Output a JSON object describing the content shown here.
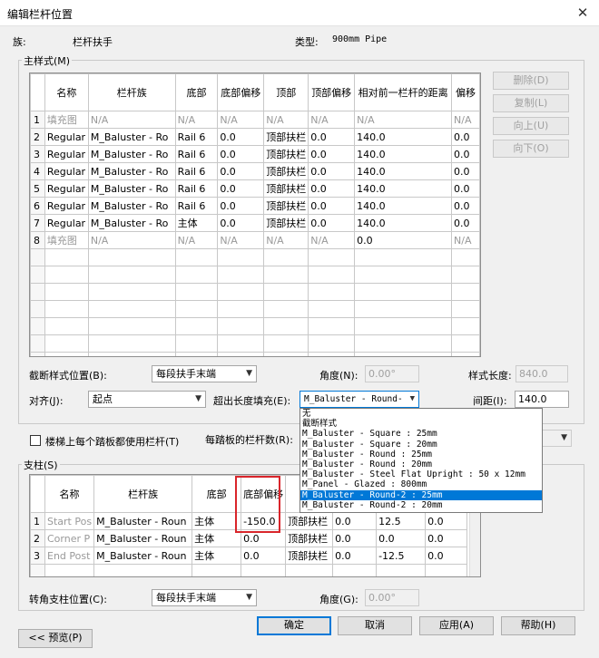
{
  "window": {
    "title": "编辑栏杆位置",
    "close_glyph": "✕"
  },
  "family": {
    "label": "族:",
    "value": "栏杆扶手",
    "type_label": "类型:",
    "type_value": "900mm Pipe"
  },
  "main_pattern": {
    "title": "主样式(M)",
    "columns": [
      "",
      "名称",
      "栏杆族",
      "底部",
      "底部偏移",
      "顶部",
      "顶部偏移",
      "相对前一栏杆的距离",
      "偏移"
    ],
    "rows": [
      [
        "1",
        "填充图",
        "N/A",
        "N/A",
        "N/A",
        "N/A",
        "N/A",
        "N/A",
        "N/A"
      ],
      [
        "2",
        "Regular",
        "M_Baluster - Ro",
        "Rail 6",
        "0.0",
        "顶部扶栏",
        "0.0",
        "140.0",
        "0.0"
      ],
      [
        "3",
        "Regular",
        "M_Baluster - Ro",
        "Rail 6",
        "0.0",
        "顶部扶栏",
        "0.0",
        "140.0",
        "0.0"
      ],
      [
        "4",
        "Regular",
        "M_Baluster - Ro",
        "Rail 6",
        "0.0",
        "顶部扶栏",
        "0.0",
        "140.0",
        "0.0"
      ],
      [
        "5",
        "Regular",
        "M_Baluster - Ro",
        "Rail 6",
        "0.0",
        "顶部扶栏",
        "0.0",
        "140.0",
        "0.0"
      ],
      [
        "6",
        "Regular",
        "M_Baluster - Ro",
        "Rail 6",
        "0.0",
        "顶部扶栏",
        "0.0",
        "140.0",
        "0.0"
      ],
      [
        "7",
        "Regular",
        "M_Baluster - Ro",
        "主体",
        "0.0",
        "顶部扶栏",
        "0.0",
        "140.0",
        "0.0"
      ],
      [
        "8",
        "填充图",
        "N/A",
        "N/A",
        "N/A",
        "N/A",
        "N/A",
        "0.0",
        "N/A"
      ]
    ],
    "buttons": {
      "delete": "删除(D)",
      "copy": "复制(L)",
      "up": "向上(U)",
      "down": "向下(O)"
    },
    "break_label": "截断样式位置(B):",
    "break_value": "每段扶手末端",
    "angle_label": "角度(N):",
    "angle_value": "0.00°",
    "length_label": "样式长度:",
    "length_value": "840.0",
    "justify_label": "对齐(J):",
    "justify_value": "起点",
    "excess_label": "超出长度填充(E):",
    "excess_value": "M_Baluster - Round-",
    "spacing_label": "间距(I):",
    "spacing_value": "140.0"
  },
  "dropdown": {
    "items": [
      "无",
      "截断样式",
      "M_Baluster - Square : 25mm",
      "M_Baluster - Square : 20mm",
      "M_Baluster - Round : 25mm",
      "M_Baluster - Round : 20mm",
      "M_Baluster - Steel Flat Upright : 50 x 12mm",
      "M_Panel - Glazed : 800mm",
      "M_Baluster - Round-2 : 25mm",
      "M_Baluster - Round-2 : 20mm"
    ],
    "selected_index": 8
  },
  "stair": {
    "checkbox_label": "楼梯上每个踏板都使用栏杆(T)",
    "per_tread_label": "每踏板的栏杆数(R):",
    "family_fragment": "d"
  },
  "posts": {
    "title": "支柱(S)",
    "columns": [
      "",
      "名称",
      "栏杆族",
      "底部",
      "底部偏移",
      "顶",
      "",
      "",
      ""
    ],
    "rows": [
      [
        "1",
        "Start Pos",
        "M_Baluster - Roun",
        "主体",
        "-150.0",
        "顶部扶栏",
        "0.0",
        "12.5",
        "0.0"
      ],
      [
        "2",
        "Corner P",
        "M_Baluster - Roun",
        "主体",
        "0.0",
        "顶部扶栏",
        "0.0",
        "0.0",
        "0.0"
      ],
      [
        "3",
        "End Post",
        "M_Baluster - Roun",
        "主体",
        "0.0",
        "顶部扶栏",
        "0.0",
        "-12.5",
        "0.0"
      ]
    ],
    "corner_label": "转角支柱位置(C):",
    "corner_value": "每段扶手末端",
    "angle_label": "角度(G):",
    "angle_value": "0.00°"
  },
  "footer": {
    "preview": "<< 预览(P)",
    "ok": "确定",
    "cancel": "取消",
    "apply": "应用(A)",
    "help": "帮助(H)"
  },
  "colors": {
    "accent": "#0078d7",
    "highlight_red": "#d9252b"
  }
}
